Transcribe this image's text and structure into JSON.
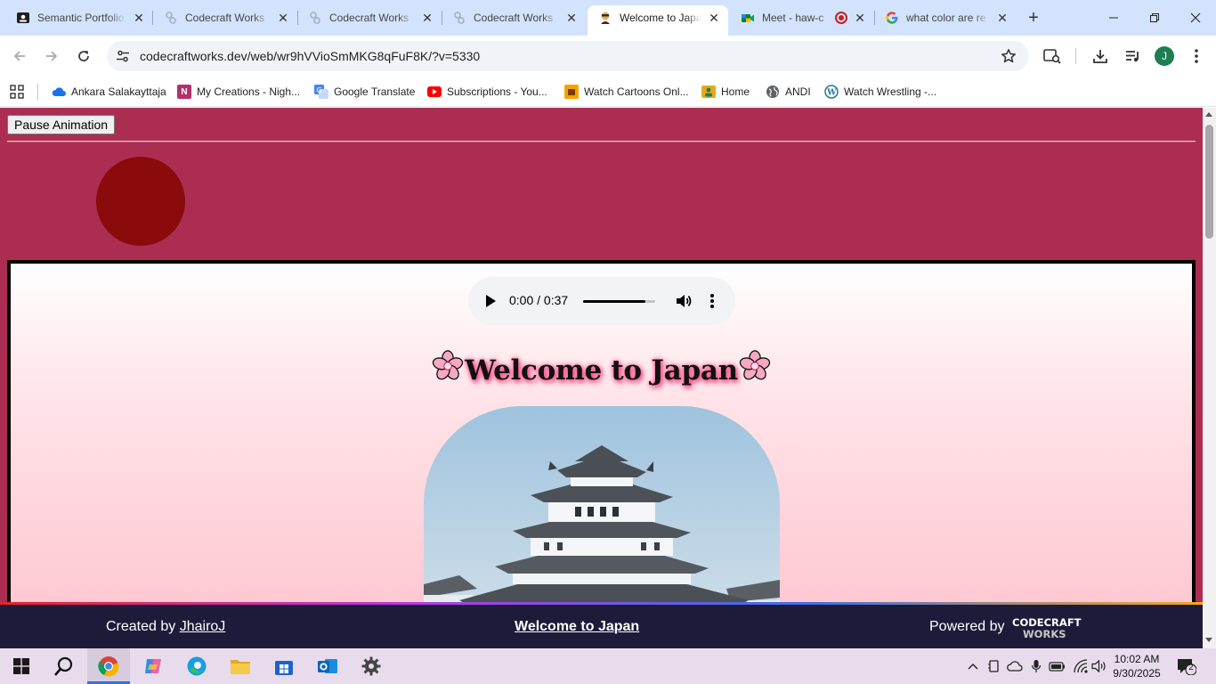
{
  "browser": {
    "tabs": [
      {
        "title": "Semantic Portfolio",
        "favicon": "portfolio-favicon"
      },
      {
        "title": "Codecraft Works",
        "favicon": "codecraft-favicon"
      },
      {
        "title": "Codecraft Works",
        "favicon": "codecraft-favicon"
      },
      {
        "title": "Codecraft Works",
        "favicon": "codecraft-favicon"
      },
      {
        "title": "Welcome to Japan",
        "favicon": "japan-favicon",
        "active": true
      },
      {
        "title": "Meet - haw-c",
        "favicon": "meet-favicon",
        "recording": true
      },
      {
        "title": "what color are re",
        "favicon": "google-favicon"
      }
    ],
    "url": "codecraftworks.dev/web/wr9hVVioSmMKG8qFuF8K/?v=5330",
    "profile_initial": "J",
    "bookmarks": [
      {
        "label": "Ankara Salakayttaja",
        "icon": "onedrive-icon",
        "color": "#1a73e8"
      },
      {
        "label": "My Creations - Nigh...",
        "icon": "creations-icon",
        "color": "#b3306a"
      },
      {
        "label": "Google Translate",
        "icon": "translate-icon",
        "color": "#4285f4"
      },
      {
        "label": "Subscriptions - You...",
        "icon": "youtube-icon",
        "color": "#ff0000"
      },
      {
        "label": "Watch Cartoons Onl...",
        "icon": "cartoons-icon",
        "color": "#f5a300"
      },
      {
        "label": "Home",
        "icon": "home-icon",
        "color": "#e6a91a"
      },
      {
        "label": "ANDI",
        "icon": "globe-icon",
        "color": "#5f6368"
      },
      {
        "label": "Watch Wrestling -...",
        "icon": "wordpress-icon",
        "color": "#21759b"
      }
    ]
  },
  "page": {
    "pause_button": "Pause Animation",
    "audio": {
      "time": "0:00 / 0:37",
      "volume_level": 0.86
    },
    "title": "Welcome to Japan",
    "footer": {
      "created_by": "Created by",
      "author": "JhairoJ",
      "center_link": "Welcome to Japan",
      "powered_by": "Powered by",
      "logo_top": "CODECRAFT",
      "logo_bottom": "WORKS"
    },
    "colors": {
      "background": "#ab2d51",
      "sun": "#8b0a0c",
      "footer": "#1e1b3a"
    }
  },
  "taskbar": {
    "time": "10:02 AM",
    "date": "9/30/2025",
    "notification_count": "2"
  }
}
